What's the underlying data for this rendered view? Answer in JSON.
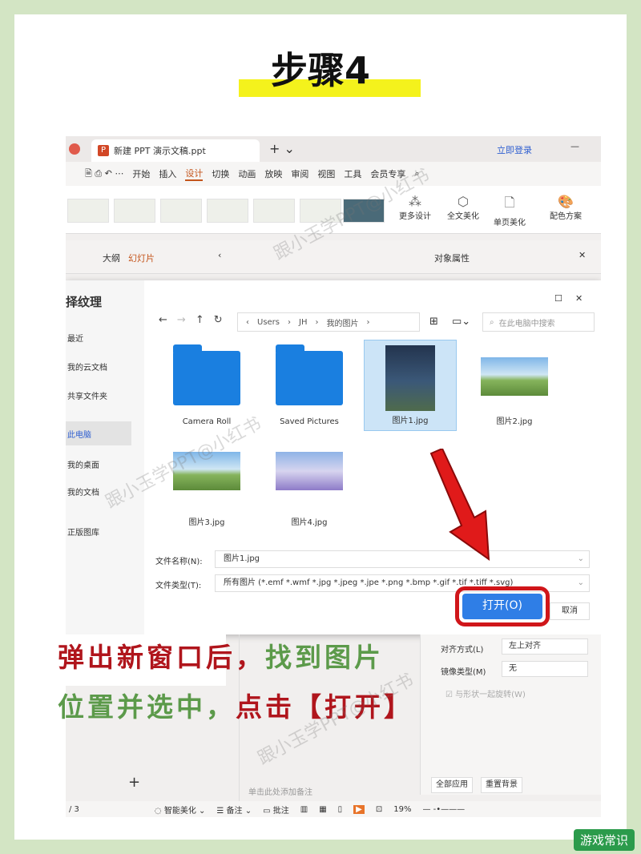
{
  "header": {
    "title": "步骤4"
  },
  "app": {
    "tab_title": "新建 PPT 演示文稿.ppt",
    "login": "立即登录",
    "menu": [
      "开始",
      "插入",
      "设计",
      "切换",
      "动画",
      "放映",
      "审阅",
      "视图",
      "工具",
      "会员专享"
    ],
    "active_menu": "设计",
    "ribbon": [
      "更多设计",
      "全文美化",
      "单页美化",
      "配色方案"
    ],
    "pane_tabs": [
      "大纲",
      "幻灯片"
    ],
    "props_title": "对象属性"
  },
  "dialog": {
    "title": "择纹理",
    "sidebar": [
      "最近",
      "我的云文档",
      "共享文件夹",
      "此电脑",
      "我的桌面",
      "我的文档",
      "正版图库"
    ],
    "sidebar_selected": "此电脑",
    "breadcrumb": [
      "Users",
      "JH",
      "我的图片"
    ],
    "search_placeholder": "在此电脑中搜索",
    "files": [
      {
        "name": "Camera Roll",
        "type": "folder"
      },
      {
        "name": "Saved Pictures",
        "type": "folder"
      },
      {
        "name": "图片1.jpg",
        "type": "image",
        "selected": true
      },
      {
        "name": "图片2.jpg",
        "type": "image"
      },
      {
        "name": "图片3.jpg",
        "type": "image"
      },
      {
        "name": "图片4.jpg",
        "type": "image"
      }
    ],
    "filename_label": "文件名称(N):",
    "filename_value": "图片1.jpg",
    "filetype_label": "文件类型(T):",
    "filetype_value": "所有图片 (*.emf *.wmf *.jpg *.jpeg *.jpe *.png *.bmp *.gif *.tif *.tiff *.svg)",
    "open_label": "打开(O)",
    "cancel_label": "取消"
  },
  "caption": {
    "line1_red": "弹出新窗口后，",
    "line1_green": "找到图片",
    "line2_green": "位置并选中，",
    "line2_red": "点击【打开】"
  },
  "props": {
    "align_label": "对齐方式(L)",
    "align_value": "左上对齐",
    "mirror_label": "镜像类型(M)",
    "mirror_value": "无",
    "rotate_label": "与形状一起旋转(W)",
    "apply_all": "全部应用",
    "reset_bg": "重置背景"
  },
  "notes_placeholder": "单击此处添加备注",
  "status": {
    "page": "/ 3",
    "smart": "智能美化",
    "notes": "备注",
    "comment": "批注",
    "zoom": "19%"
  },
  "watermark": "跟小玉学PPT@小红书",
  "logo": "游戏常识",
  "colors": {
    "accent": "#c4541b",
    "open_button": "#2f7ee6",
    "highlight": "#d0161a"
  }
}
